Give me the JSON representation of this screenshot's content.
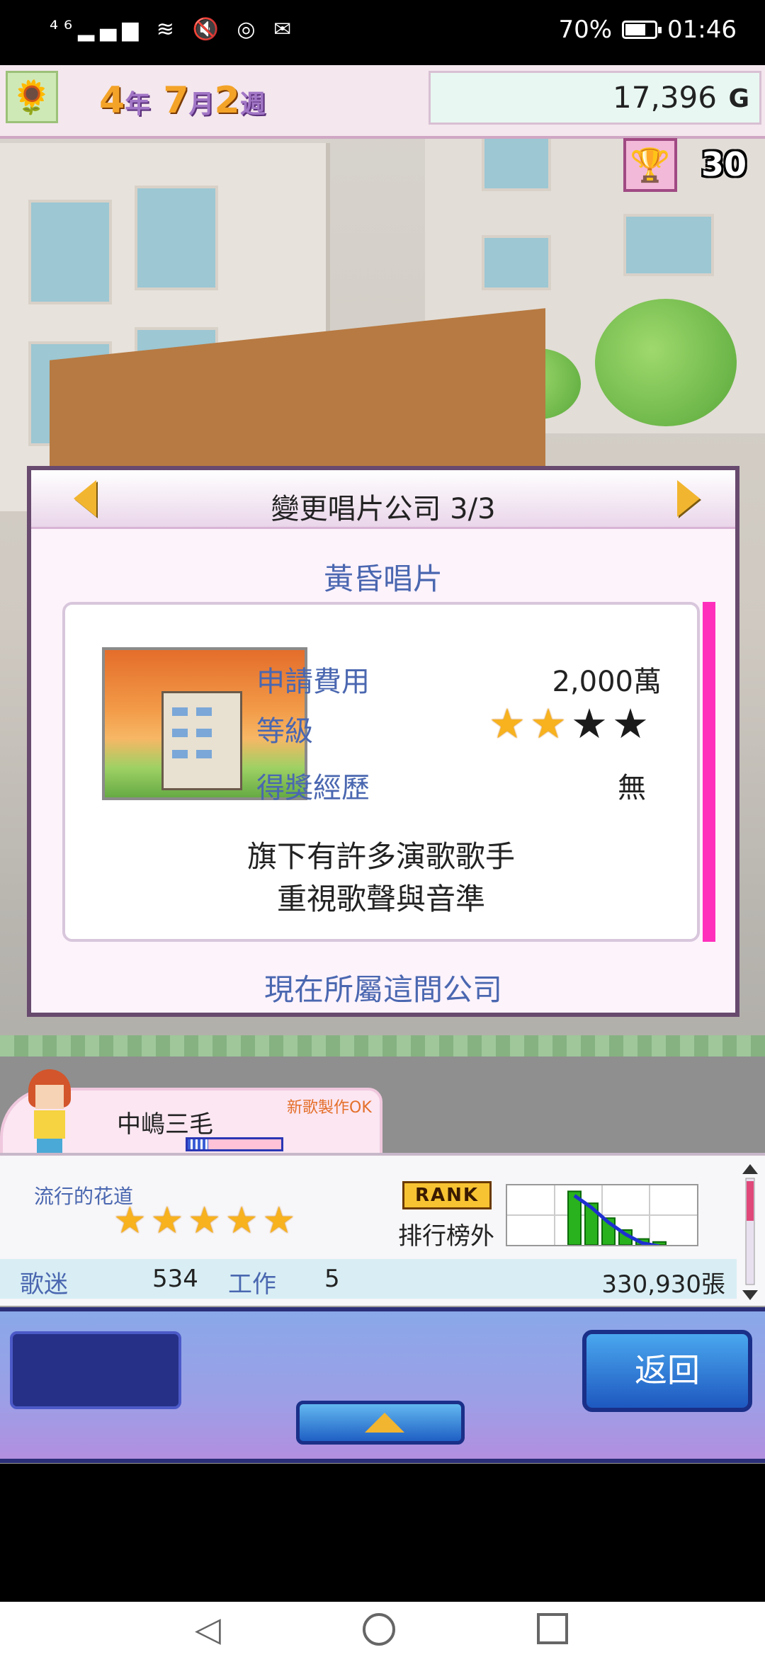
{
  "status_bar": {
    "signal": "⁴⁶▂▄▆ ≋ 🔇 ◎ ✉",
    "battery": "70%",
    "battery_level": 0.7,
    "time": "01:46"
  },
  "top_bar": {
    "year_num": "4",
    "year_unit": "年",
    "month_num": "7",
    "month_unit": "月",
    "week_num": "2",
    "week_unit": "週",
    "money": "17,396",
    "currency": "G",
    "trophy_count": "30"
  },
  "dialog": {
    "title": "變更唱片公司 3/3",
    "company_name": "黃昏唱片",
    "fee_label": "申請費用",
    "fee_value": "2,000萬",
    "level_label": "等級",
    "level_stars": 2,
    "level_max": 4,
    "award_label": "得獎經歷",
    "award_value": "無",
    "desc_line1": "旗下有許多演歌歌手",
    "desc_line2": "重視歌聲與音準",
    "current_company_text": "現在所屬這間公司"
  },
  "artist": {
    "name": "中嶋三毛",
    "status": "新歌製作OK",
    "progress": 0.22
  },
  "info": {
    "route_label": "流行的花道",
    "route_stars": 5,
    "rank_badge": "RANK",
    "rank_text": "排行榜外",
    "rank_chart": [
      90,
      70,
      45,
      25,
      10,
      5
    ],
    "fans_label": "歌迷",
    "fans_value": "534",
    "work_label": "工作",
    "work_value": "5",
    "sales": "330,930張"
  },
  "buttons": {
    "back_label": "返回"
  },
  "colors": {
    "accent": "#4a67b0",
    "dialog_border": "#684a6e",
    "scrollbar": "#ff2fbc",
    "star_on": "#f7b21e",
    "chart_bar": "#29b21d",
    "chart_line": "#1e2fd0"
  }
}
